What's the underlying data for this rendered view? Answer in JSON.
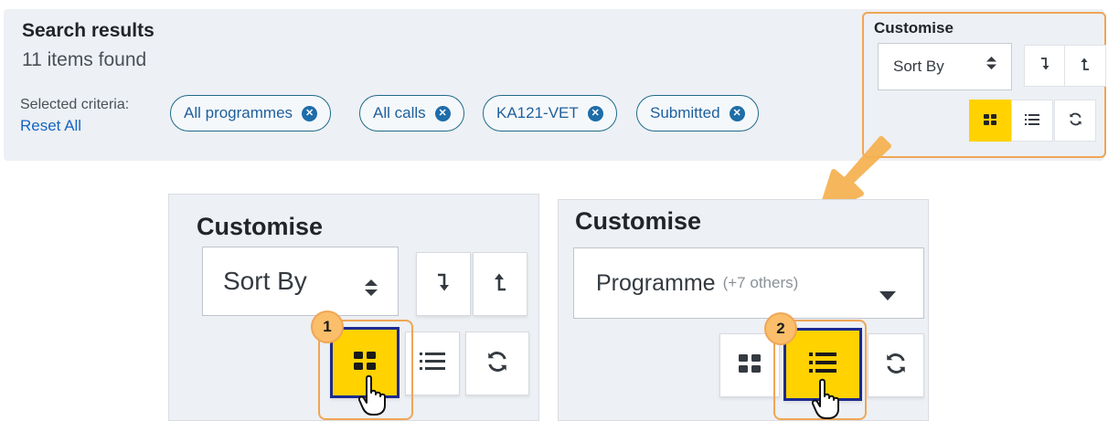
{
  "search": {
    "title": "Search results",
    "count": "11 items found",
    "criteria_label": "Selected criteria:",
    "reset_label": "Reset All",
    "chips": [
      {
        "label": "All programmes"
      },
      {
        "label": "All calls"
      },
      {
        "label": "KA121-VET"
      },
      {
        "label": "Submitted"
      }
    ]
  },
  "mini_customise": {
    "title": "Customise",
    "sort_value": "Sort By",
    "view_mode": "grid"
  },
  "customise_1": {
    "title": "Customise",
    "sort_value": "Sort By",
    "step": "1",
    "active_view": "grid"
  },
  "customise_2": {
    "title": "Customise",
    "sort_value": "Programme",
    "sort_extra": "(+7 others)",
    "step": "2",
    "active_view": "list"
  },
  "colors": {
    "accent_yellow": "#ffd200",
    "highlight_orange": "#f0a556",
    "chip_border": "#1f6b8a",
    "link_blue": "#1565c0",
    "panel_bg": "#edf0f4"
  },
  "icons": [
    "remove-chip-icon",
    "sort-updown-icon",
    "sort-descending-icon",
    "sort-ascending-icon",
    "grid-view-icon",
    "list-view-icon",
    "refresh-icon",
    "hand-cursor-icon",
    "arrow-annotation-icon",
    "caret-down-icon"
  ]
}
